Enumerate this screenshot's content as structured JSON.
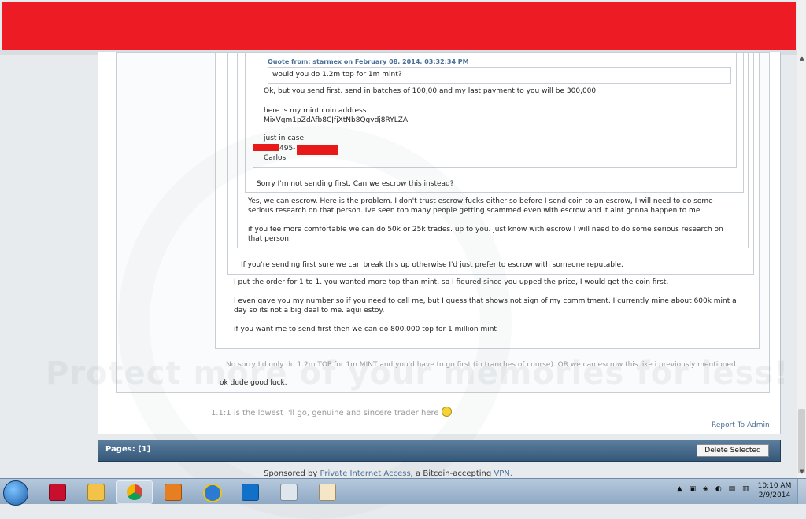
{
  "quote_header": "Quote from: starmex on February 08, 2014, 03:32:34 PM",
  "posts": {
    "q6_text": "would you do 1.2m top for 1m mint?",
    "q5_lines": [
      "Ok, but you send first. send in batches of 100,00 and my last payment to you will be 300,000",
      "here is my mint coin address",
      "MixVqm1pZdAfb8CJfjXtNb8Qgvdj8RYLZA",
      "just in case",
      "495-",
      "Carlos"
    ],
    "q4_text": "Sorry I'm not sending first. Can we escrow this instead?",
    "q3_lines": [
      "Yes, we can escrow. Here is the problem. I don't trust escrow fucks either so before I send coin to an escrow, I will need to do some",
      "serious research on that person. Ive seen too many people getting scammed even with escrow and it aint gonna happen to me.",
      "if you fee more comfortable we can do 50k or 25k trades. up to you. just know with escrow I will need to do some serious research on",
      "that person."
    ],
    "q2_text": "If you're sending first sure we can break this up otherwise I'd just prefer to escrow with someone reputable.",
    "q1_lines": [
      "I put the order for 1 to 1. you wanted more top than mint, so I figured since you upped the price, I would get the coin first.",
      "I even gave you my number so if you need to call me, but I guess that shows not sign of my commitment.  I currently mine about 600k mint a",
      "day so its not a big deal to me. aqui estoy.",
      "if you want me to send first then we can do 800,000 top for 1 million mint"
    ],
    "q0_text": "No sorry I'd only do 1.2m TOP for 1m MINT and you'd have to go first (in tranches of course). OR we can escrow this like i previously mentioned.",
    "reply_text": "ok dude good luck."
  },
  "signature": "1.1:1 is the lowest i'll go, genuine and sincere trader here",
  "report_link": "Report To Admin",
  "pages_label": "Pages: [1]",
  "delete_button": "Delete Selected",
  "sponsor": {
    "prefix": "Sponsored by ",
    "link1": "Private Internet Access",
    "middle": ", a Bitcoin-accepting ",
    "link2": "VPN."
  },
  "watermark": "Protect more of your memories for less!",
  "taskbar": {
    "clock_time": "10:10 AM",
    "clock_date": "2/9/2014",
    "apps": [
      "app-red",
      "file-explorer",
      "chrome",
      "media-player",
      "internet-explorer",
      "teamviewer",
      "calculator",
      "paint"
    ]
  },
  "colors": {
    "redaction": "#ed1c24",
    "link": "#4a6f96",
    "pages_bar": "#35587a"
  }
}
